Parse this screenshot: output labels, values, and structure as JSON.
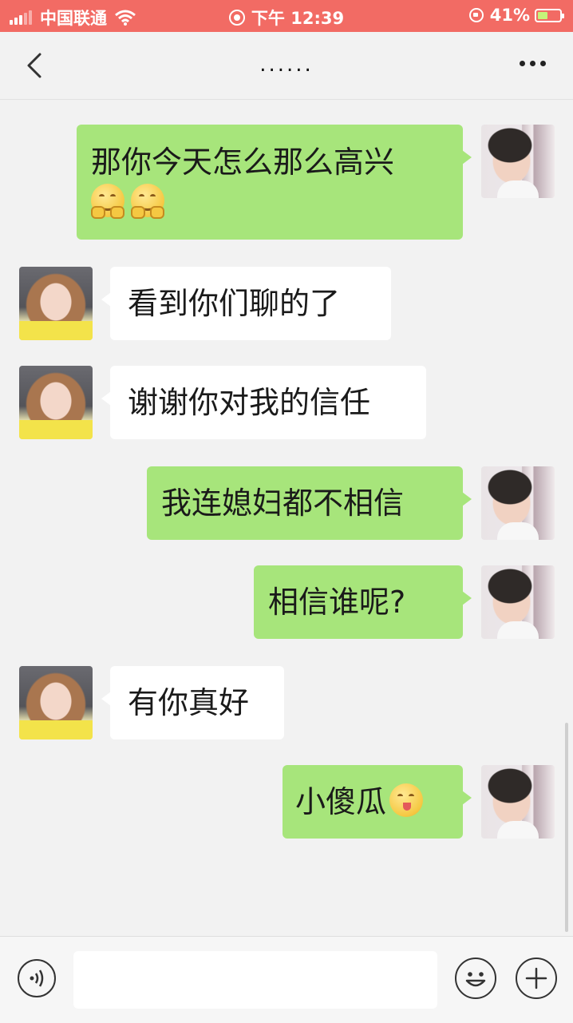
{
  "status_bar": {
    "carrier": "中国联通",
    "time": "下午 12:39",
    "battery": "41%",
    "accent_color": "#f26b64"
  },
  "nav": {
    "title": "......",
    "back_icon": "chevron-left-icon",
    "more_icon": "more-icon"
  },
  "messages": [
    {
      "side": "out",
      "text": "那你今天怎么那么高兴",
      "emoji": "grin-hands-emoji x2"
    },
    {
      "side": "in",
      "text": "看到你们聊的了"
    },
    {
      "side": "in",
      "text": "谢谢你对我的信任"
    },
    {
      "side": "out",
      "text": "我连媳妇都不相信"
    },
    {
      "side": "out",
      "text": "相信谁呢?"
    },
    {
      "side": "in",
      "text": "有你真好"
    },
    {
      "side": "out",
      "text": "小傻瓜",
      "emoji": "tongue-emoji"
    }
  ],
  "input_bar": {
    "voice_icon": "voice-icon",
    "input_value": "",
    "emoji_icon": "smiley-icon",
    "add_icon": "plus-icon"
  },
  "colors": {
    "outgoing_bubble": "#a7e57b",
    "incoming_bubble": "#ffffff",
    "background": "#f2f2f2"
  }
}
